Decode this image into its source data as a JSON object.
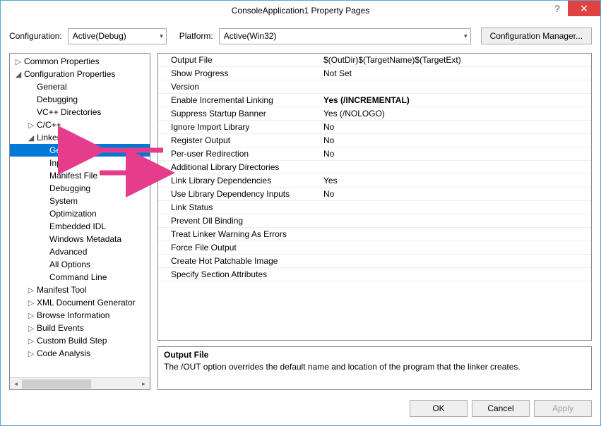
{
  "window": {
    "title": "ConsoleApplication1 Property Pages"
  },
  "configRow": {
    "configLabel": "Configuration:",
    "configValue": "Active(Debug)",
    "platformLabel": "Platform:",
    "platformValue": "Active(Win32)",
    "managerLabel": "Configuration Manager..."
  },
  "tree": [
    {
      "label": "Common Properties",
      "depth": 0,
      "expander": "▷"
    },
    {
      "label": "Configuration Properties",
      "depth": 0,
      "expander": "◢"
    },
    {
      "label": "General",
      "depth": 1,
      "expander": ""
    },
    {
      "label": "Debugging",
      "depth": 1,
      "expander": ""
    },
    {
      "label": "VC++ Directories",
      "depth": 1,
      "expander": ""
    },
    {
      "label": "C/C++",
      "depth": 1,
      "expander": "▷"
    },
    {
      "label": "Linker",
      "depth": 1,
      "expander": "◢"
    },
    {
      "label": "General",
      "depth": 2,
      "expander": "",
      "selected": true
    },
    {
      "label": "Input",
      "depth": 2,
      "expander": ""
    },
    {
      "label": "Manifest File",
      "depth": 2,
      "expander": ""
    },
    {
      "label": "Debugging",
      "depth": 2,
      "expander": ""
    },
    {
      "label": "System",
      "depth": 2,
      "expander": ""
    },
    {
      "label": "Optimization",
      "depth": 2,
      "expander": ""
    },
    {
      "label": "Embedded IDL",
      "depth": 2,
      "expander": ""
    },
    {
      "label": "Windows Metadata",
      "depth": 2,
      "expander": ""
    },
    {
      "label": "Advanced",
      "depth": 2,
      "expander": ""
    },
    {
      "label": "All Options",
      "depth": 2,
      "expander": ""
    },
    {
      "label": "Command Line",
      "depth": 2,
      "expander": ""
    },
    {
      "label": "Manifest Tool",
      "depth": 1,
      "expander": "▷"
    },
    {
      "label": "XML Document Generator",
      "depth": 1,
      "expander": "▷"
    },
    {
      "label": "Browse Information",
      "depth": 1,
      "expander": "▷"
    },
    {
      "label": "Build Events",
      "depth": 1,
      "expander": "▷"
    },
    {
      "label": "Custom Build Step",
      "depth": 1,
      "expander": "▷"
    },
    {
      "label": "Code Analysis",
      "depth": 1,
      "expander": "▷"
    }
  ],
  "props": [
    {
      "name": "Output File",
      "value": "$(OutDir)$(TargetName)$(TargetExt)"
    },
    {
      "name": "Show Progress",
      "value": "Not Set"
    },
    {
      "name": "Version",
      "value": ""
    },
    {
      "name": "Enable Incremental Linking",
      "value": "Yes (/INCREMENTAL)",
      "bold": true
    },
    {
      "name": "Suppress Startup Banner",
      "value": "Yes (/NOLOGO)"
    },
    {
      "name": "Ignore Import Library",
      "value": "No"
    },
    {
      "name": "Register Output",
      "value": "No"
    },
    {
      "name": "Per-user Redirection",
      "value": "No"
    },
    {
      "name": "Additional Library Directories",
      "value": ""
    },
    {
      "name": "Link Library Dependencies",
      "value": "Yes"
    },
    {
      "name": "Use Library Dependency Inputs",
      "value": "No"
    },
    {
      "name": "Link Status",
      "value": ""
    },
    {
      "name": "Prevent Dll Binding",
      "value": ""
    },
    {
      "name": "Treat Linker Warning As Errors",
      "value": ""
    },
    {
      "name": "Force File Output",
      "value": ""
    },
    {
      "name": "Create Hot Patchable Image",
      "value": ""
    },
    {
      "name": "Specify Section Attributes",
      "value": ""
    }
  ],
  "desc": {
    "title": "Output File",
    "body": "The /OUT option overrides the default name and location of the program that the linker creates."
  },
  "buttons": {
    "ok": "OK",
    "cancel": "Cancel",
    "apply": "Apply"
  },
  "colors": {
    "annotation": "#e63c8c"
  }
}
